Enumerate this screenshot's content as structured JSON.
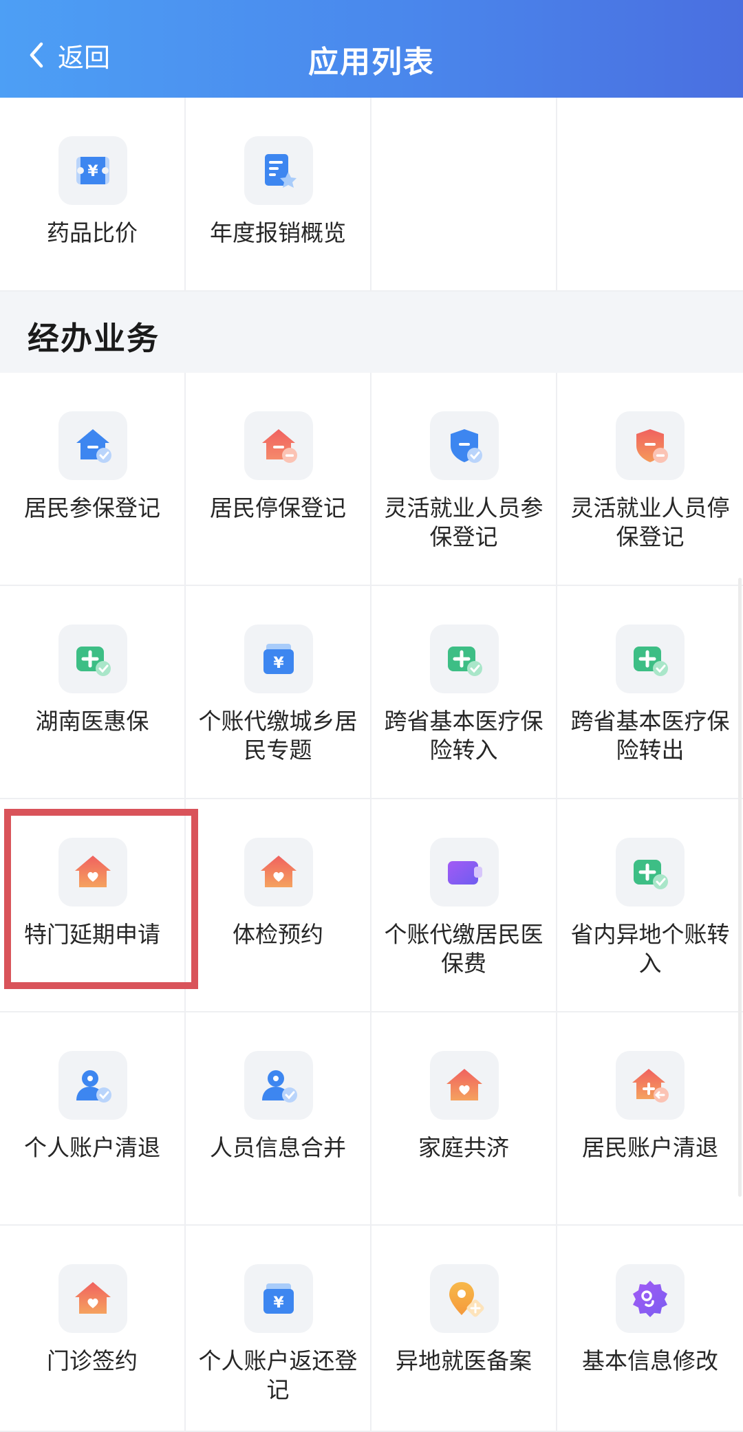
{
  "header": {
    "back_label": "返回",
    "title": "应用列表"
  },
  "section": {
    "title": "经办业务"
  },
  "top_items": [
    {
      "label": "药品比价",
      "icon": "ticket-yuan-icon"
    },
    {
      "label": "年度报销概览",
      "icon": "document-star-icon"
    }
  ],
  "items": [
    {
      "label": "居民参保登记",
      "icon": "house-check-icon"
    },
    {
      "label": "居民停保登记",
      "icon": "house-minus-icon"
    },
    {
      "label": "灵活就业人员参保登记",
      "icon": "shield-check-icon"
    },
    {
      "label": "灵活就业人员停保登记",
      "icon": "shield-minus-icon"
    },
    {
      "label": "湖南医惠保",
      "icon": "medical-plus-check-icon"
    },
    {
      "label": "个账代缴城乡居民专题",
      "icon": "wallet-yuan-icon"
    },
    {
      "label": "跨省基本医疗保险转入",
      "icon": "medical-plus-check-icon"
    },
    {
      "label": "跨省基本医疗保险转出",
      "icon": "medical-plus-check-icon"
    },
    {
      "label": "特门延期申请",
      "icon": "house-heart-icon"
    },
    {
      "label": "体检预约",
      "icon": "house-heart-icon"
    },
    {
      "label": "个账代缴居民医保费",
      "icon": "purple-wallet-icon"
    },
    {
      "label": "省内异地个账转入",
      "icon": "medical-plus-check-icon"
    },
    {
      "label": "个人账户清退",
      "icon": "person-check-icon"
    },
    {
      "label": "人员信息合并",
      "icon": "person-check-icon"
    },
    {
      "label": "家庭共济",
      "icon": "house-heart-icon"
    },
    {
      "label": "居民账户清退",
      "icon": "house-plus-arrow-icon"
    },
    {
      "label": "门诊签约",
      "icon": "house-heart-icon"
    },
    {
      "label": "个人账户返还登记",
      "icon": "wallet-yuan-icon"
    },
    {
      "label": "异地就医备案",
      "icon": "location-plus-icon"
    },
    {
      "label": "基本信息修改",
      "icon": "badge-settings-icon"
    }
  ],
  "highlighted_item": "特门延期申请"
}
